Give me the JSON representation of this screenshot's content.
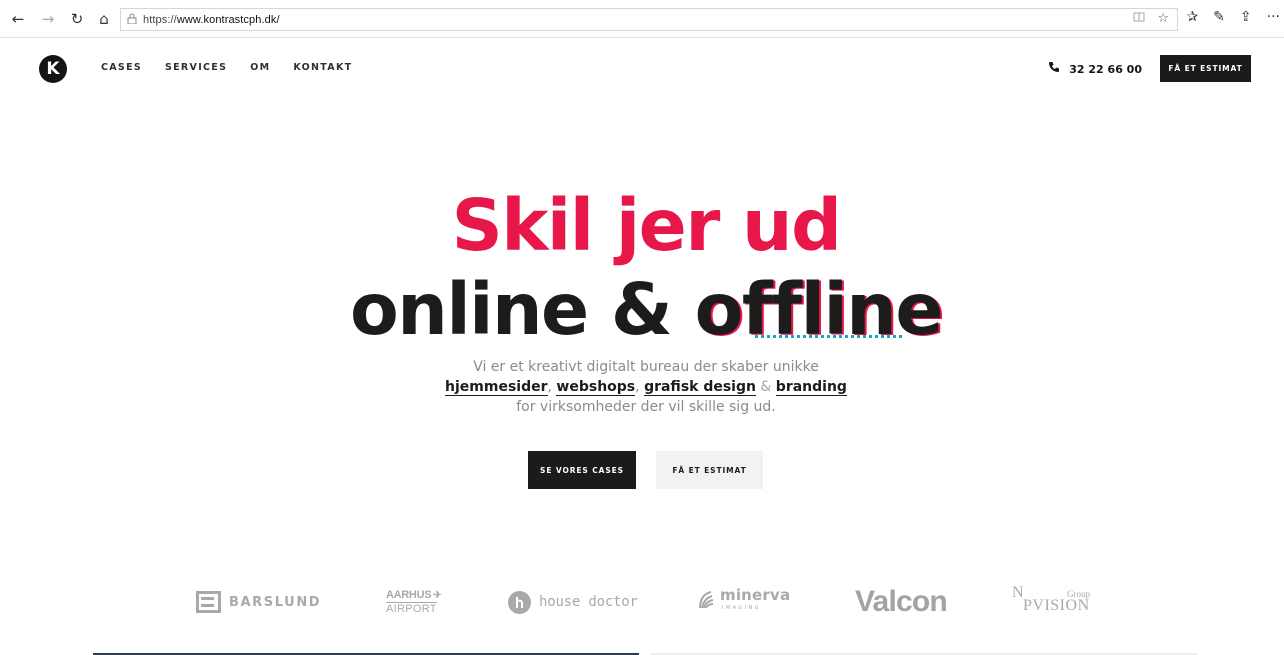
{
  "browser": {
    "back_icon": "←",
    "forward_icon": "→",
    "refresh_icon": "↻",
    "home_icon": "⌂",
    "lock_icon": "🔒",
    "url_prefix": "https://",
    "url_host": "www.kontrastcph.dk/",
    "reading_view_icon": "📖",
    "favorite_icon": "☆",
    "favorites_bar_icon": "✰",
    "pen_icon": "✎",
    "share_icon": "⇪",
    "more_icon": "···"
  },
  "header": {
    "logo_text": "K",
    "nav": [
      "CASES",
      "SERVICES",
      "OM",
      "KONTAKT"
    ],
    "phone_icon": "✆",
    "phone": "32 22 66 00",
    "cta": "FÅ ET ESTIMAT"
  },
  "hero": {
    "line1": "Skil jer ud",
    "line2_prefix": "online & ",
    "line2_highlight": "offline",
    "sub_line1": "Vi er et kreativt digitalt bureau der skaber unikke",
    "kw1": "hjemmesider",
    "comma1": ", ",
    "kw2": "webshops",
    "comma2": ", ",
    "kw3": "grafisk design",
    "amp": " & ",
    "kw4": "branding",
    "sub_line3": "for virksomheder der vil skille sig ud.",
    "primary_button": "SE VORES CASES",
    "secondary_button": "FÅ ET ESTIMAT"
  },
  "clients": {
    "barslund": "BARSLUND",
    "aarhus_line1": "AARHUS",
    "aarhus_line2": "AIRPORT",
    "house_doctor": "house doctor",
    "minerva": "minerva",
    "minerva_sub": "IMAGING",
    "valcon": "Valcon",
    "pvision_n": "N",
    "pvision_group": "Group",
    "pvision_main": "PVISION"
  },
  "colors": {
    "accent": "#e8174a",
    "dark": "#1c1c1c",
    "underline_accent": "#19a7c9"
  }
}
